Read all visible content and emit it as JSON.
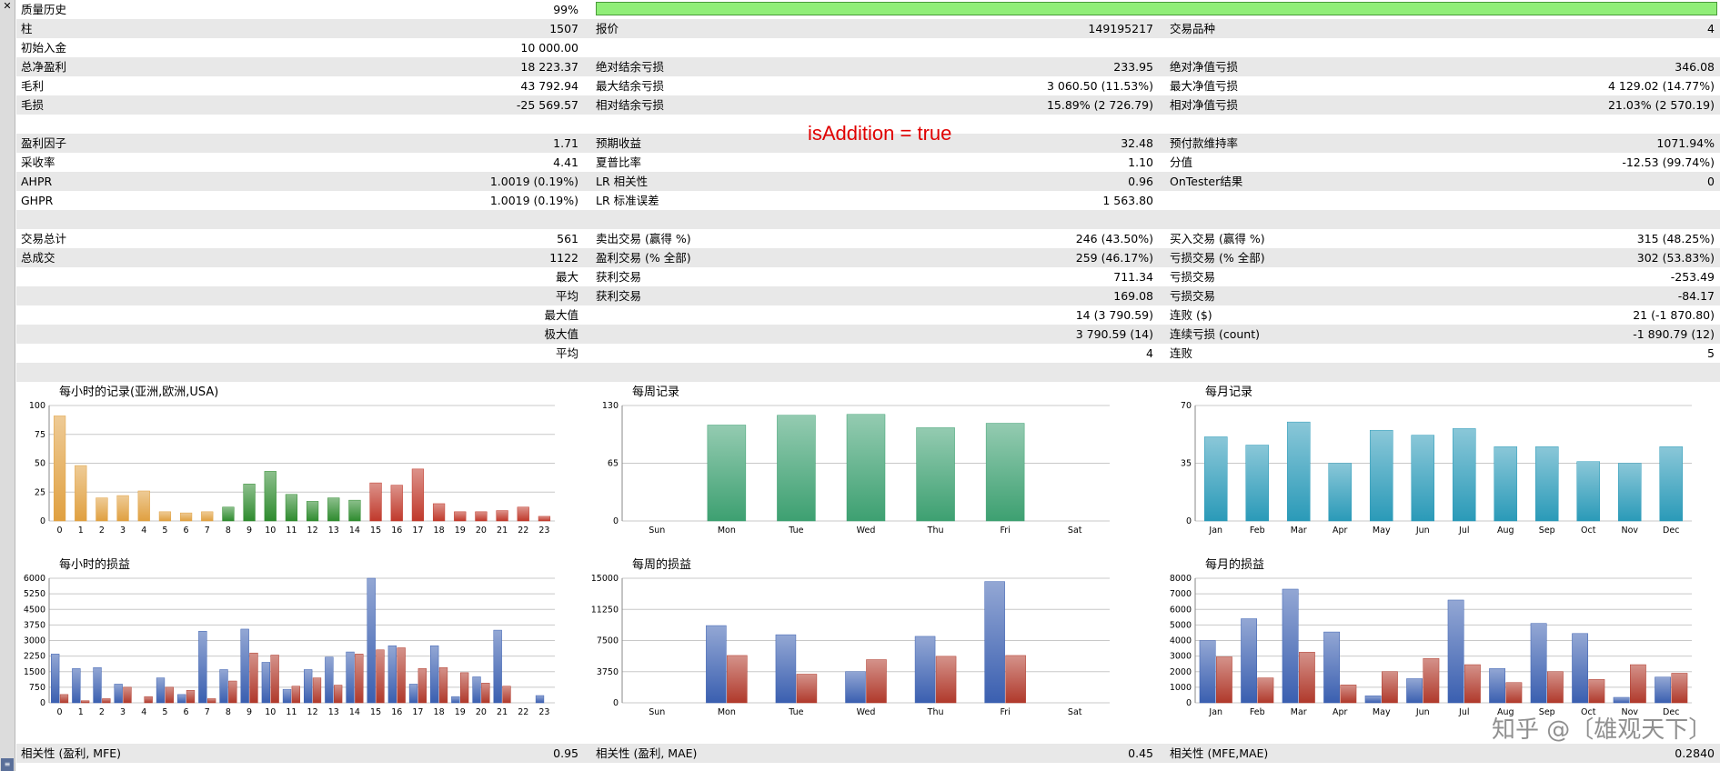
{
  "annotation": "isAddition = true",
  "quality": {
    "label": "质量历史",
    "value": "99%",
    "bar_fraction": 1.0
  },
  "rows": [
    {
      "shade": true,
      "c1l": "柱",
      "c1v": "1507",
      "c2l": "报价",
      "c2v": "149195217",
      "c3l": "交易品种",
      "c3v": "4"
    },
    {
      "shade": false,
      "c1l": "初始入金",
      "c1v": "10 000.00",
      "c2l": "",
      "c2v": "",
      "c3l": "",
      "c3v": ""
    },
    {
      "shade": true,
      "c1l": "总净盈利",
      "c1v": "18 223.37",
      "c2l": "绝对结余亏损",
      "c2v": "233.95",
      "c3l": "绝对净值亏损",
      "c3v": "346.08"
    },
    {
      "shade": false,
      "c1l": "毛利",
      "c1v": "43 792.94",
      "c2l": "最大结余亏损",
      "c2v": "3 060.50 (11.53%)",
      "c3l": "最大净值亏损",
      "c3v": "4 129.02 (14.77%)"
    },
    {
      "shade": true,
      "c1l": "毛损",
      "c1v": "-25 569.57",
      "c2l": "相对结余亏损",
      "c2v": "15.89% (2 726.79)",
      "c3l": "相对净值亏损",
      "c3v": "21.03% (2 570.19)"
    },
    {
      "shade": false,
      "c1l": "",
      "c1v": "",
      "c2l": "",
      "c2v": "",
      "c3l": "",
      "c3v": ""
    },
    {
      "shade": true,
      "c1l": "盈利因子",
      "c1v": "1.71",
      "c2l": "预期收益",
      "c2v": "32.48",
      "c3l": "预付款维持率",
      "c3v": "1071.94%"
    },
    {
      "shade": false,
      "c1l": "采收率",
      "c1v": "4.41",
      "c2l": "夏普比率",
      "c2v": "1.10",
      "c3l": "分值",
      "c3v": "-12.53 (99.74%)"
    },
    {
      "shade": true,
      "c1l": "AHPR",
      "c1v": "1.0019 (0.19%)",
      "c2l": "LR 相关性",
      "c2v": "0.96",
      "c3l": "OnTester结果",
      "c3v": "0"
    },
    {
      "shade": false,
      "c1l": "GHPR",
      "c1v": "1.0019 (0.19%)",
      "c2l": "LR 标准误差",
      "c2v": "1 563.80",
      "c3l": "",
      "c3v": ""
    },
    {
      "shade": true,
      "c1l": "",
      "c1v": "",
      "c2l": "",
      "c2v": "",
      "c3l": "",
      "c3v": ""
    },
    {
      "shade": false,
      "c1l": "交易总计",
      "c1v": "561",
      "c2l": "卖出交易 (赢得 %)",
      "c2v": "246 (43.50%)",
      "c3l": "买入交易 (赢得 %)",
      "c3v": "315 (48.25%)"
    },
    {
      "shade": true,
      "c1l": "总成交",
      "c1v": "1122",
      "c2l": "盈利交易 (% 全部)",
      "c2v": "259 (46.17%)",
      "c3l": "亏损交易 (% 全部)",
      "c3v": "302 (53.83%)"
    },
    {
      "shade": false,
      "c1l": "",
      "c1v": "最大",
      "c2l": "获利交易",
      "c2v": "711.34",
      "c3l": "亏损交易",
      "c3v": "-253.49"
    },
    {
      "shade": true,
      "c1l": "",
      "c1v": "平均",
      "c2l": "获利交易",
      "c2v": "169.08",
      "c3l": "亏损交易",
      "c3v": "-84.17"
    },
    {
      "shade": false,
      "c1l": "",
      "c1v": "最大值",
      "c2l": "",
      "c2v": "14 (3 790.59)",
      "c3l": "连败 ($)",
      "c3v": "21 (-1 870.80)"
    },
    {
      "shade": true,
      "c1l": "",
      "c1v": "极大值",
      "c2l": "",
      "c2v": "3 790.59 (14)",
      "c3l": "连续亏损 (count)",
      "c3v": "-1 890.79 (12)"
    },
    {
      "shade": false,
      "c1l": "",
      "c1v": "平均",
      "c2l": "",
      "c2v": "4",
      "c3l": "连败",
      "c3v": "5"
    },
    {
      "shade": true,
      "c1l": "",
      "c1v": "",
      "c2l": "",
      "c2v": "",
      "c3l": "",
      "c3v": ""
    }
  ],
  "footer": {
    "c1l": "相关性 (盈利, MFE)",
    "c1v": "0.95",
    "c2l": "相关性 (盈利, MAE)",
    "c2v": "0.45",
    "c3l": "相关性 (MFE,MAE)",
    "c3v": "0.2840"
  },
  "watermark": "知乎 @〔雄观天下〕",
  "chart_data": [
    {
      "type": "bar",
      "title": "每小时的记录(亚洲,欧洲,USA)",
      "categories": [
        "0",
        "1",
        "2",
        "3",
        "4",
        "5",
        "6",
        "7",
        "8",
        "9",
        "10",
        "11",
        "12",
        "13",
        "14",
        "15",
        "16",
        "17",
        "18",
        "19",
        "20",
        "21",
        "22",
        "23"
      ],
      "yticks": [
        "0",
        "25",
        "50",
        "75",
        "100"
      ],
      "ylim": [
        0,
        100
      ],
      "values": [
        91,
        48,
        20,
        22,
        26,
        8,
        7,
        8,
        12,
        32,
        43,
        23,
        17,
        20,
        18,
        33,
        31,
        45,
        15,
        8,
        8,
        9,
        12,
        4
      ],
      "colors": [
        "#e0a040",
        "#e0a040",
        "#e0a040",
        "#e0a040",
        "#e0a040",
        "#e0a040",
        "#e0a040",
        "#e0a040",
        "#2e8b2e",
        "#2e8b2e",
        "#2e8b2e",
        "#2e8b2e",
        "#2e8b2e",
        "#2e8b2e",
        "#2e8b2e",
        "#c0392b",
        "#c0392b",
        "#c0392b",
        "#c0392b",
        "#c0392b",
        "#c0392b",
        "#c0392b",
        "#c0392b",
        "#c0392b"
      ]
    },
    {
      "type": "bar",
      "title": "每周记录",
      "categories": [
        "Sun",
        "Mon",
        "Tue",
        "Wed",
        "Thu",
        "Fri",
        "Sat"
      ],
      "yticks": [
        "0",
        "65",
        "130"
      ],
      "ylim": [
        0,
        130
      ],
      "values": [
        0,
        108,
        119,
        120,
        105,
        110,
        0
      ],
      "color": "#3da071"
    },
    {
      "type": "bar",
      "title": "每月记录",
      "categories": [
        "Jan",
        "Feb",
        "Mar",
        "Apr",
        "May",
        "Jun",
        "Jul",
        "Aug",
        "Sep",
        "Oct",
        "Nov",
        "Dec"
      ],
      "yticks": [
        "0",
        "35",
        "70"
      ],
      "ylim": [
        0,
        70
      ],
      "values": [
        51,
        46,
        60,
        35,
        55,
        52,
        56,
        45,
        45,
        36,
        35,
        45
      ],
      "color": "#2a9ab8"
    },
    {
      "type": "bar",
      "title": "每小时的损益",
      "categories": [
        "0",
        "1",
        "2",
        "3",
        "4",
        "5",
        "6",
        "7",
        "8",
        "9",
        "10",
        "11",
        "12",
        "13",
        "14",
        "15",
        "16",
        "17",
        "18",
        "19",
        "20",
        "21",
        "22",
        "23"
      ],
      "yticks": [
        "0",
        "750",
        "1500",
        "2250",
        "3000",
        "3750",
        "4500",
        "5250",
        "6000"
      ],
      "ylim": [
        0,
        6000
      ],
      "series": [
        {
          "name": "profit",
          "color": "#3a5fb0",
          "values": [
            2350,
            1650,
            1700,
            900,
            0,
            1200,
            400,
            3450,
            1600,
            3550,
            1950,
            650,
            1600,
            2200,
            2450,
            6000,
            2750,
            900,
            2750,
            300,
            1250,
            3500,
            0,
            350
          ]
        },
        {
          "name": "loss",
          "color": "#b0392b",
          "values": [
            400,
            100,
            200,
            750,
            300,
            750,
            600,
            200,
            1050,
            2400,
            2300,
            800,
            1200,
            850,
            2350,
            2550,
            2650,
            1650,
            1700,
            1450,
            950,
            800,
            0,
            0
          ]
        }
      ]
    },
    {
      "type": "bar",
      "title": "每周的损益",
      "categories": [
        "Sun",
        "Mon",
        "Tue",
        "Wed",
        "Thu",
        "Fri",
        "Sat"
      ],
      "yticks": [
        "0",
        "3750",
        "7500",
        "11250",
        "15000"
      ],
      "ylim": [
        0,
        15000
      ],
      "series": [
        {
          "name": "profit",
          "color": "#3a5fb0",
          "values": [
            0,
            9300,
            8200,
            3750,
            8000,
            14600,
            0
          ]
        },
        {
          "name": "loss",
          "color": "#b0392b",
          "values": [
            0,
            5700,
            3450,
            5200,
            5600,
            5700,
            0
          ]
        }
      ]
    },
    {
      "type": "bar",
      "title": "每月的损益",
      "categories": [
        "Jan",
        "Feb",
        "Mar",
        "Apr",
        "May",
        "Jun",
        "Jul",
        "Aug",
        "Sep",
        "Oct",
        "Nov",
        "Dec"
      ],
      "yticks": [
        "0",
        "1000",
        "2000",
        "3000",
        "4000",
        "5000",
        "6000",
        "7000",
        "8000"
      ],
      "ylim": [
        0,
        8000
      ],
      "series": [
        {
          "name": "profit",
          "color": "#3a5fb0",
          "values": [
            4000,
            5400,
            7300,
            4550,
            450,
            1550,
            6600,
            2200,
            5100,
            4450,
            350,
            1650
          ]
        },
        {
          "name": "loss",
          "color": "#b0392b",
          "values": [
            2950,
            1600,
            3250,
            1150,
            2000,
            2850,
            2450,
            1300,
            2000,
            1500,
            2450,
            1900
          ]
        }
      ]
    }
  ]
}
